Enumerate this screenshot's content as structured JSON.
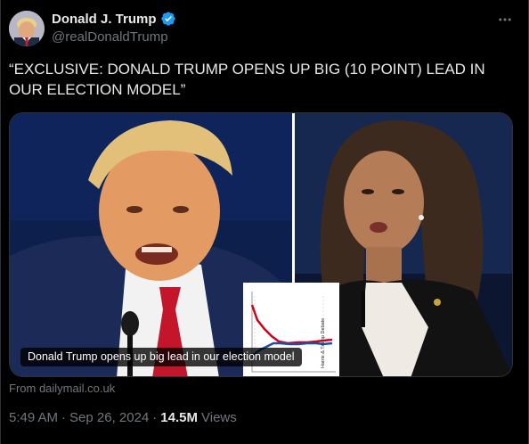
{
  "author": {
    "display_name": "Donald J. Trump",
    "handle": "@realDonaldTrump",
    "verified": true,
    "accent_color": "#1d9bf0"
  },
  "post": {
    "text": "“EXCLUSIVE: DONALD TRUMP OPENS UP BIG (10 POINT) LEAD IN OUR ELECTION MODEL”"
  },
  "media": {
    "caption": "Donald Trump opens up big lead in our election model",
    "inset_chart_labels": [
      "Harris & Trump Debate"
    ]
  },
  "link_card": {
    "source": "From dailymail.co.uk"
  },
  "meta": {
    "time": "5:49 AM",
    "date": "Sep 26, 2024",
    "separator": "·",
    "views": "14.5M",
    "views_label": "Views"
  },
  "icons": {
    "verified": "verified-badge-icon",
    "more": "more-options-icon"
  }
}
